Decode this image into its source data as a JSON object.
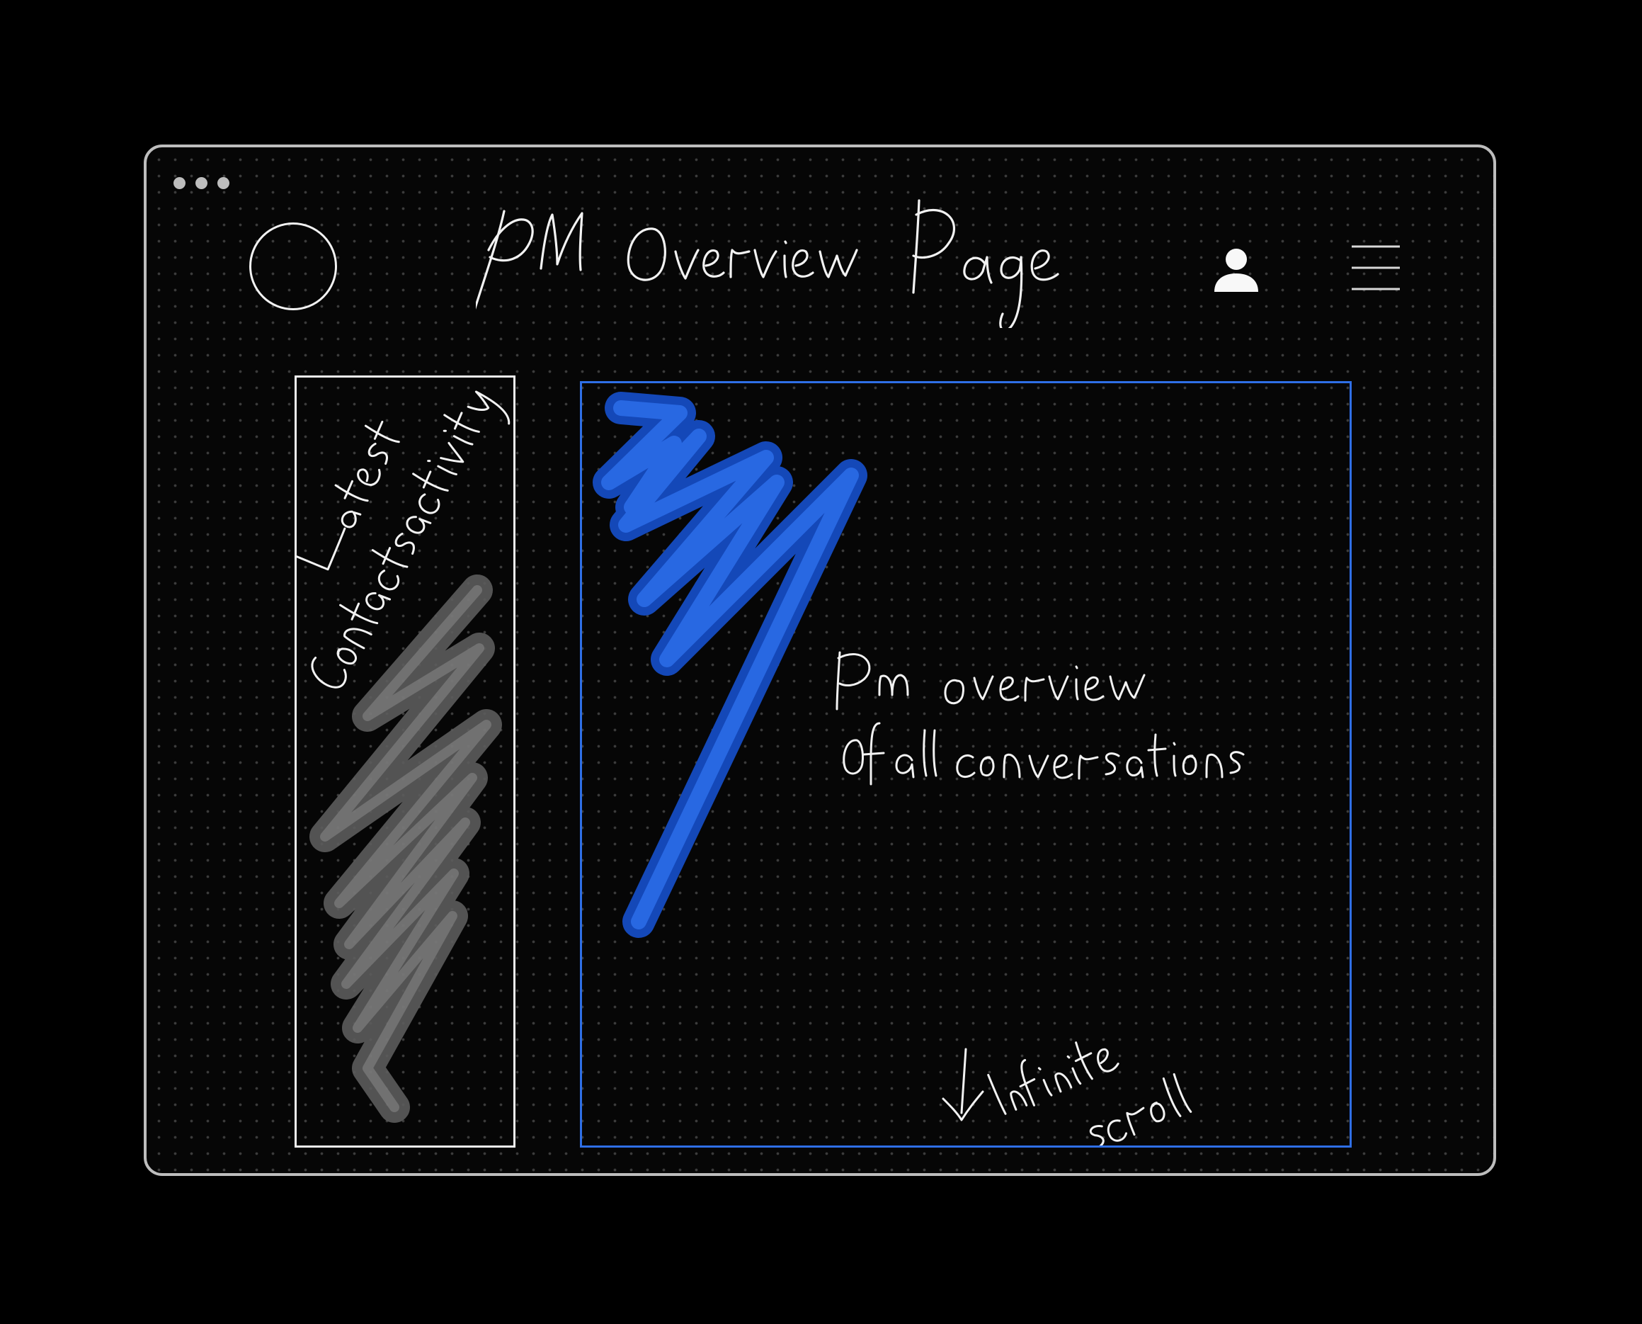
{
  "window": {
    "title": "PM Overview Page"
  },
  "header": {
    "logo_icon": "circle-logo",
    "user_icon": "user-icon",
    "menu_icon": "hamburger-menu-icon"
  },
  "sidebar": {
    "label_line1": "Latest",
    "label_line2": "Contacts activity",
    "content_placeholder": "scribble-gray"
  },
  "main": {
    "label_line1": "Pm overview",
    "label_line2": "of all conversations",
    "scroll_note_line1": "Infinite",
    "scroll_note_line2": "scroll",
    "scroll_icon": "arrow-down-icon",
    "content_placeholder": "scribble-blue"
  },
  "colors": {
    "background": "#000000",
    "frame": "#bdbdbd",
    "ink": "#f2f2f2",
    "accent_blue": "#2f6fe6",
    "scribble_blue": "#1d5fd8",
    "scribble_gray": "#6f6f6f"
  }
}
